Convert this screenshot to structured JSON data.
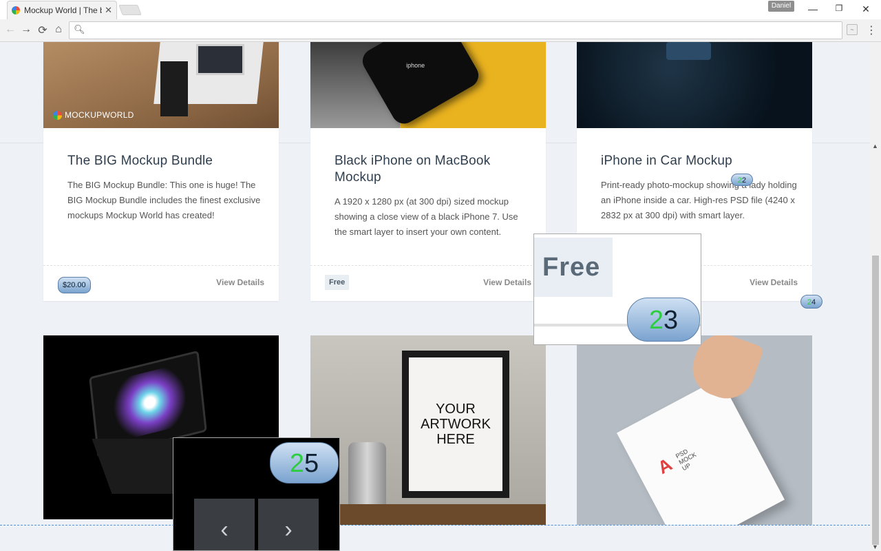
{
  "browser": {
    "tab_title": "Mockup World | The best",
    "user": "Daniel",
    "address_value": ""
  },
  "cards": [
    {
      "title": "The BIG Mockup Bundle",
      "desc": "The BIG Mockup Bundle: This one is huge! The BIG Mockup Bundle includes the finest exclusive mockups Mockup World has created!",
      "price": "$20.00",
      "view": "View Details",
      "brand": "MOCKUPWORLD"
    },
    {
      "title": "Black iPhone on MacBook Mockup",
      "desc": "A 1920 x 1280 px (at 300 dpi) sized mockup showing a close view of a black iPhone 7. Use the smart layer to insert your own content.",
      "price": "Free",
      "view": "View Details",
      "phone_text": "iphone"
    },
    {
      "title": "iPhone in Car Mockup",
      "desc": "Print-ready photo-mockup showing a lady holding an iPhone inside a car. High-res PSD file (4240 x 2832 px at 300 dpi) with smart layer.",
      "view": "View Details"
    }
  ],
  "bottom": {
    "frame_text": [
      "YOUR",
      "ARTWORK",
      "HERE"
    ],
    "paper_text": "PSD MOCK UP"
  },
  "bubbles": {
    "b22": "22",
    "b24": "24",
    "b23": "23",
    "b25": "25"
  },
  "magnifier": {
    "free_label": "Free"
  },
  "colors": {
    "accent_green": "#2ecc40",
    "bubble_blue": "#7aa3cf",
    "page_bg": "#eef2f6"
  }
}
